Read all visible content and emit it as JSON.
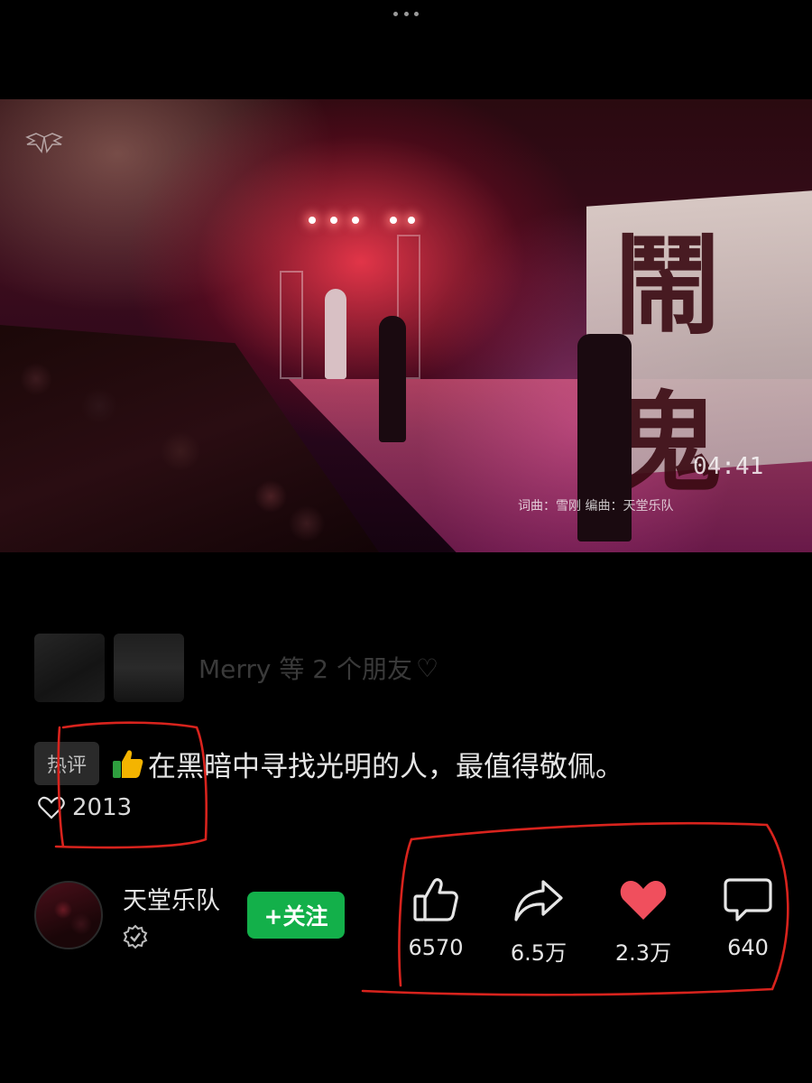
{
  "video": {
    "timestamp": "04:41",
    "credits": "词曲：雪刚 编曲：天堂乐队",
    "banner_text": "鬧鬼"
  },
  "friends": {
    "text": "Merry 等 2 个朋友"
  },
  "hot_comment": {
    "badge": "热评",
    "text": "在黑暗中寻找光明的人，最值得敬佩。",
    "likes": "2013"
  },
  "author": {
    "name": "天堂乐队",
    "follow_label": "+关注"
  },
  "actions": [
    {
      "name": "like",
      "count": "6570",
      "icon": "thumbs-up-icon"
    },
    {
      "name": "share",
      "count": "6.5万",
      "icon": "share-arrow-icon"
    },
    {
      "name": "favorite",
      "count": "2.3万",
      "icon": "heart-icon",
      "color": "#f04f5d"
    },
    {
      "name": "comment",
      "count": "640",
      "icon": "comment-bubble-icon"
    }
  ],
  "colors": {
    "background": "#000000",
    "follow_green": "#13b04a",
    "heart_red": "#f04f5d",
    "annotation_red": "#d8231d"
  }
}
